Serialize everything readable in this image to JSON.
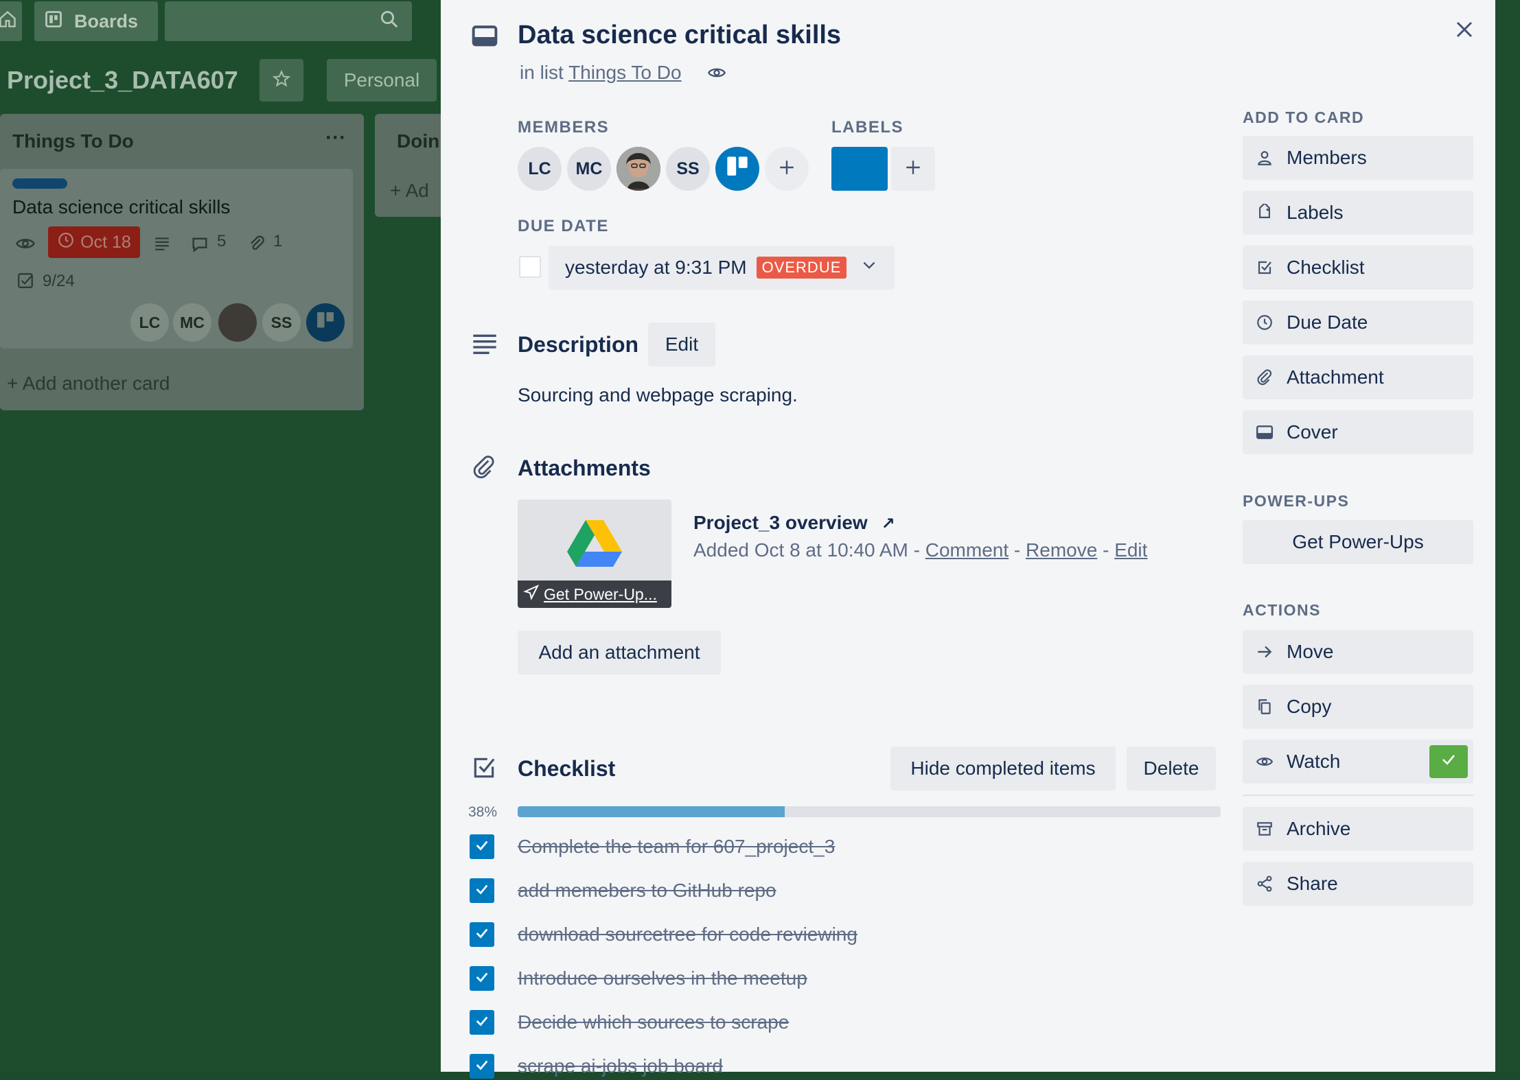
{
  "board": {
    "nav": {
      "boards_label": "Boards"
    },
    "title": "Project_3_DATA607",
    "personal_label": "Personal",
    "lists": [
      {
        "title": "Things To Do",
        "menu": "···"
      },
      {
        "title": "Doin",
        "add": "Ad"
      }
    ],
    "card": {
      "title": "Data science critical skills",
      "due": "Oct 18",
      "comments": "5",
      "attachments": "1",
      "checklist": "9/24",
      "members": [
        "LC",
        "MC",
        "SS"
      ]
    },
    "add_card_label": "Add another card"
  },
  "modal": {
    "title": "Data science critical skills",
    "in_list_prefix": "in list",
    "list_name": "Things To Do",
    "members_heading": "MEMBERS",
    "members": [
      "LC",
      "MC",
      "SS"
    ],
    "labels_heading": "LABELS",
    "label_color": "#0079bf",
    "due_heading": "DUE DATE",
    "due_text": "yesterday at 9:31 PM",
    "overdue_badge": "OVERDUE",
    "description_heading": "Description",
    "edit_label": "Edit",
    "description_text": "Sourcing and webpage scraping.",
    "attachments_heading": "Attachments",
    "attachment": {
      "thumb_caption": "Get Power-Up...",
      "name": "Project_3 overview",
      "added_text": "Added Oct 8 at 10:40 AM -",
      "comment": "Comment",
      "remove": "Remove",
      "edit": "Edit",
      "sep": "-"
    },
    "add_attachment_label": "Add an attachment",
    "checklist_heading": "Checklist",
    "hide_completed_label": "Hide completed items",
    "delete_label": "Delete",
    "progress_text": "38%",
    "progress_fraction": 0.38,
    "checklist_items": [
      "Complete the team for 607_project_3",
      "add memebers to GitHub repo",
      "download sourcetree for code reviewing",
      "Introduce ourselves in the meetup",
      "Decide which sources to scrape",
      "scrape ai-jobs job board"
    ]
  },
  "sidebar": {
    "add_to_card_heading": "ADD TO CARD",
    "add_to_card": [
      "Members",
      "Labels",
      "Checklist",
      "Due Date",
      "Attachment",
      "Cover"
    ],
    "powerups_heading": "POWER-UPS",
    "get_powerups": "Get Power-Ups",
    "actions_heading": "ACTIONS",
    "actions": [
      "Move",
      "Copy",
      "Watch",
      "Archive",
      "Share"
    ]
  },
  "colors": {
    "board_bg": "#1e4d2e",
    "overdue": "#eb5a46",
    "check_blue": "#0079bf",
    "watch_green": "#5aac44",
    "progress": "#5ba4cf"
  }
}
